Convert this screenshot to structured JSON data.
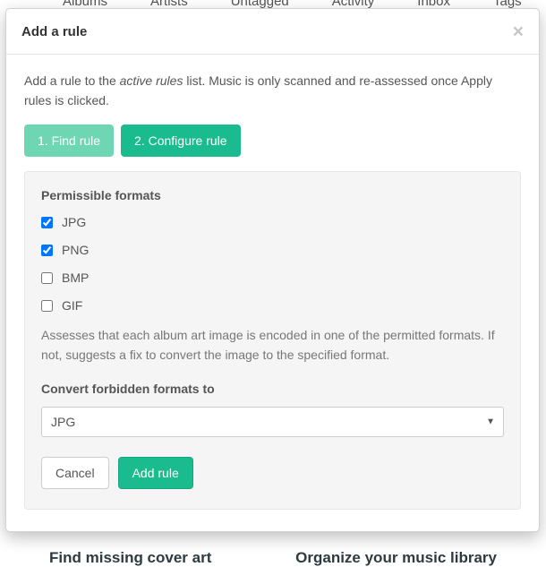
{
  "background": {
    "nav": [
      "Albums",
      "Artists",
      "Untagged",
      "Activity",
      "Inbox",
      "Tags"
    ],
    "bottom_left": "Find missing cover art",
    "bottom_right": "Organize your music library"
  },
  "modal": {
    "title": "Add a rule",
    "close_glyph": "×",
    "intro_pre": "Add a rule to the ",
    "intro_em": "active rules",
    "intro_post": " list. Music is only scanned and re-assessed once Apply rules is clicked.",
    "steps": {
      "find": "1. Find rule",
      "configure": "2. Configure rule"
    },
    "panel": {
      "heading": "Permissible formats",
      "formats": [
        {
          "label": "JPG",
          "checked": true
        },
        {
          "label": "PNG",
          "checked": true
        },
        {
          "label": "BMP",
          "checked": false
        },
        {
          "label": "GIF",
          "checked": false
        }
      ],
      "description": "Assesses that each album art image is encoded in one of the permitted formats. If not, suggests a fix to convert the image to the specified format.",
      "convert_label": "Convert forbidden formats to",
      "convert_value": "JPG",
      "cancel": "Cancel",
      "add": "Add rule"
    }
  }
}
